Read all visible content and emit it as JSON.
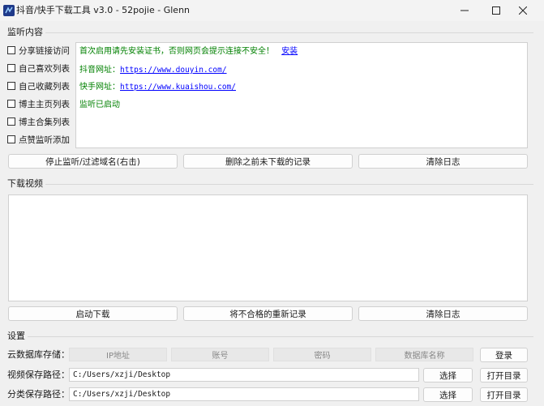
{
  "window": {
    "title": "抖音/快手下载工具 v3.0 - 52pojie - Glenn",
    "minimize": "—",
    "maximize": "☐",
    "close": "✕"
  },
  "monitor": {
    "section_label": "监听内容",
    "checkboxes": [
      {
        "label": "分享链接访问",
        "checked": false
      },
      {
        "label": "自己喜欢列表",
        "checked": false
      },
      {
        "label": "自己收藏列表",
        "checked": false
      },
      {
        "label": "博主主页列表",
        "checked": false
      },
      {
        "label": "博主合集列表",
        "checked": false
      },
      {
        "label": "点赞监听添加",
        "checked": false
      }
    ],
    "log": {
      "line1_text": "首次启用请先安装证书，否则网页会提示连接不安全！",
      "line1_link": "安装",
      "line2_label": "抖音网址：",
      "line2_link": "https://www.douyin.com/",
      "line3_label": "快手网址：",
      "line3_link": "https://www.kuaishou.com/",
      "line4_text": "监听已启动"
    },
    "buttons": {
      "stop": "停止监听/过滤域名(右击)",
      "delete_undownloaded": "删除之前未下载的记录",
      "clear_log": "清除日志"
    }
  },
  "download": {
    "section_label": "下载视频",
    "buttons": {
      "start": "启动下载",
      "rerecord": "将不合格的重新记录",
      "clear_log": "清除日志"
    }
  },
  "settings": {
    "section_label": "设置",
    "cloud_label": "云数据库存储：",
    "ip_placeholder": "IP地址",
    "account_placeholder": "账号",
    "password_placeholder": "密码",
    "dbname_placeholder": "数据库名称",
    "login": "登录",
    "video_path_label": "视频保存路径：",
    "video_path": "C:/Users/xzji/Desktop",
    "category_path_label": "分类保存路径：",
    "category_path": "C:/Users/xzji/Desktop",
    "choose": "选择",
    "open_dir": "打开目录"
  }
}
